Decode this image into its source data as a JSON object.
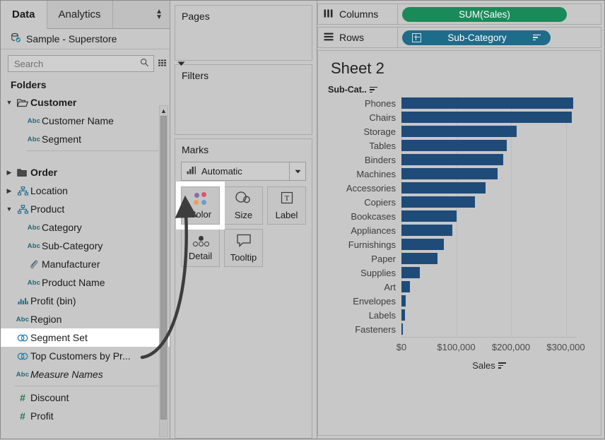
{
  "datapane": {
    "tabs": [
      {
        "label": "Data",
        "active": true
      },
      {
        "label": "Analytics",
        "active": false
      }
    ],
    "datasource": {
      "label": "Sample - Superstore",
      "icon": "database-icon"
    },
    "search": {
      "placeholder": "Search",
      "value": "",
      "icon": "search-icon",
      "grid_icon": "grid-view-icon",
      "menu_icon": "chevron-down-icon"
    },
    "folders_header": "Folders",
    "tree": [
      {
        "label": "Customer",
        "kind": "folder",
        "bold": true,
        "expanded": true,
        "indent": 0,
        "icon": "folder-open-icon"
      },
      {
        "label": "Customer Name",
        "kind": "string",
        "indent": 1,
        "icon": "abc-icon"
      },
      {
        "label": "Segment",
        "kind": "string",
        "indent": 1,
        "icon": "abc-icon"
      },
      {
        "label": "__sep__",
        "kind": "separator",
        "indent": 1
      },
      {
        "label": "Order",
        "kind": "folder",
        "bold": true,
        "expanded": false,
        "indent": 0,
        "icon": "folder-icon"
      },
      {
        "label": "Location",
        "kind": "hierarchy",
        "indent": 0,
        "icon": "hierarchy-icon"
      },
      {
        "label": "Product",
        "kind": "hierarchy",
        "expanded": true,
        "indent": 0,
        "icon": "hierarchy-icon"
      },
      {
        "label": "Category",
        "kind": "string",
        "indent": 1,
        "icon": "abc-icon"
      },
      {
        "label": "Sub-Category",
        "kind": "string",
        "indent": 1,
        "icon": "abc-icon"
      },
      {
        "label": "Manufacturer",
        "kind": "calculated",
        "indent": 1,
        "icon": "calculated-field-icon"
      },
      {
        "label": "Product Name",
        "kind": "string",
        "indent": 1,
        "icon": "abc-icon"
      },
      {
        "label": "Profit (bin)",
        "kind": "bin",
        "indent": 0,
        "icon": "bin-icon"
      },
      {
        "label": "Region",
        "kind": "string",
        "indent": 0,
        "icon": "abc-icon"
      },
      {
        "label": "Segment Set",
        "kind": "set",
        "indent": 0,
        "icon": "set-icon",
        "selected": true
      },
      {
        "label": "Top Customers by Pr...",
        "kind": "set",
        "indent": 0,
        "icon": "set-icon"
      },
      {
        "label": "Measure Names",
        "kind": "string",
        "indent": 0,
        "icon": "abc-icon",
        "italic": true
      },
      {
        "label": "__sep_full__",
        "kind": "separator",
        "indent": 0
      },
      {
        "label": "Discount",
        "kind": "measure",
        "indent": 0,
        "icon": "number-icon"
      },
      {
        "label": "Profit",
        "kind": "measure",
        "indent": 0,
        "icon": "number-icon"
      }
    ],
    "scrollbar": {
      "up_icon": "chevron-up-icon"
    }
  },
  "cards": {
    "pages": {
      "title": "Pages"
    },
    "filters": {
      "title": "Filters"
    },
    "marks": {
      "title": "Marks",
      "mark_type": {
        "value": "Automatic",
        "icon": "bar-mark-icon",
        "caret": "chevron-down-icon"
      },
      "buttons": [
        {
          "label": "Color",
          "icon": "color-dots-icon",
          "highlighted": true
        },
        {
          "label": "Size",
          "icon": "size-circles-icon",
          "highlighted": false
        },
        {
          "label": "Label",
          "icon": "label-t-icon",
          "highlighted": false
        },
        {
          "label": "Detail",
          "icon": "detail-dots-icon",
          "highlighted": false
        },
        {
          "label": "Tooltip",
          "icon": "tooltip-bubble-icon",
          "highlighted": false
        }
      ]
    }
  },
  "shelves": {
    "columns": {
      "label": "Columns",
      "icon": "columns-icon",
      "pill": {
        "text": "SUM(Sales)",
        "color": "#1a8a5a",
        "type": "measure"
      }
    },
    "rows": {
      "label": "Rows",
      "icon": "rows-icon",
      "pill": {
        "text": "Sub-Category",
        "color": "#1f6b8a",
        "type": "dimension",
        "expand_icon": "plus-box-icon",
        "sort_icon": "sort-descending-icon"
      }
    }
  },
  "worksheet": {
    "title": "Sheet 2",
    "row_header": {
      "label": "Sub-Cat..",
      "sort_icon": "sort-descending-icon"
    },
    "x_axis_title": {
      "label": "Sales",
      "sort_icon": "sort-descending-icon"
    }
  },
  "colors": {
    "bar": "#1f4b79",
    "measure_pill": "#1a8a5a",
    "dimension_pill": "#1f6b8a",
    "pane_background": "#c8c8c8",
    "selection_highlight": "#ffffff",
    "gridline": "#bdbdbd"
  },
  "chart_data": {
    "type": "bar",
    "orientation": "horizontal",
    "title": "Sheet 2",
    "xlabel": "Sales",
    "ylabel": "Sub-Category",
    "xlim": [
      0,
      320000
    ],
    "grid": true,
    "legend": "none",
    "tick_labels": [
      "$0",
      "$100,000",
      "$200,000",
      "$300,000"
    ],
    "ticks": [
      0,
      100000,
      200000,
      300000
    ],
    "categories": [
      "Phones",
      "Chairs",
      "Storage",
      "Tables",
      "Binders",
      "Machines",
      "Accessories",
      "Copiers",
      "Bookcases",
      "Appliances",
      "Furnishings",
      "Paper",
      "Supplies",
      "Art",
      "Envelopes",
      "Labels",
      "Fasteners"
    ],
    "values": [
      313000,
      311000,
      210000,
      192000,
      186000,
      176000,
      154000,
      134000,
      100000,
      93000,
      77000,
      66000,
      34000,
      15000,
      8000,
      7000,
      3000
    ]
  }
}
